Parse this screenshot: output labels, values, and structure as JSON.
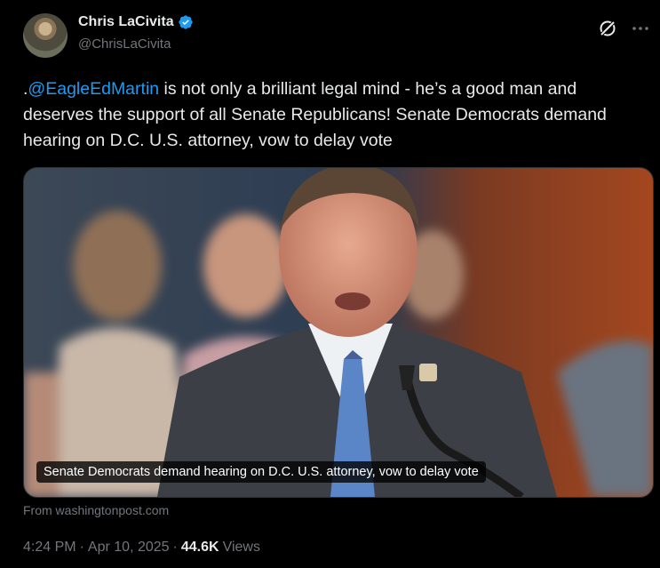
{
  "author": {
    "display_name": "Chris LaCivita",
    "handle": "@ChrisLaCivita",
    "verified": true
  },
  "tweet": {
    "prefix": ".",
    "mention": "@EagleEdMartin",
    "body": " is not only a brilliant legal mind - he’s a good man and deserves the support of all Senate Republicans! Senate Democrats demand hearing on D.C. U.S. attorney, vow to delay vote"
  },
  "card": {
    "caption": "Senate Democrats demand hearing on D.C. U.S. attorney, vow to delay vote",
    "source": "From washingtonpost.com"
  },
  "meta": {
    "time": "4:24 PM",
    "dot1": "·",
    "date": "Apr 10, 2025",
    "dot2": "·",
    "views_count": "44.6K",
    "views_label": "Views"
  },
  "colors": {
    "background": "#000000",
    "text": "#e7e9ea",
    "secondary": "#71767b",
    "link": "#1d9bf0",
    "verified_badge": "#1d9bf0"
  },
  "icons": {
    "grok": "grok-icon",
    "more": "more-horizontal-icon",
    "verified": "verified-badge-icon"
  }
}
